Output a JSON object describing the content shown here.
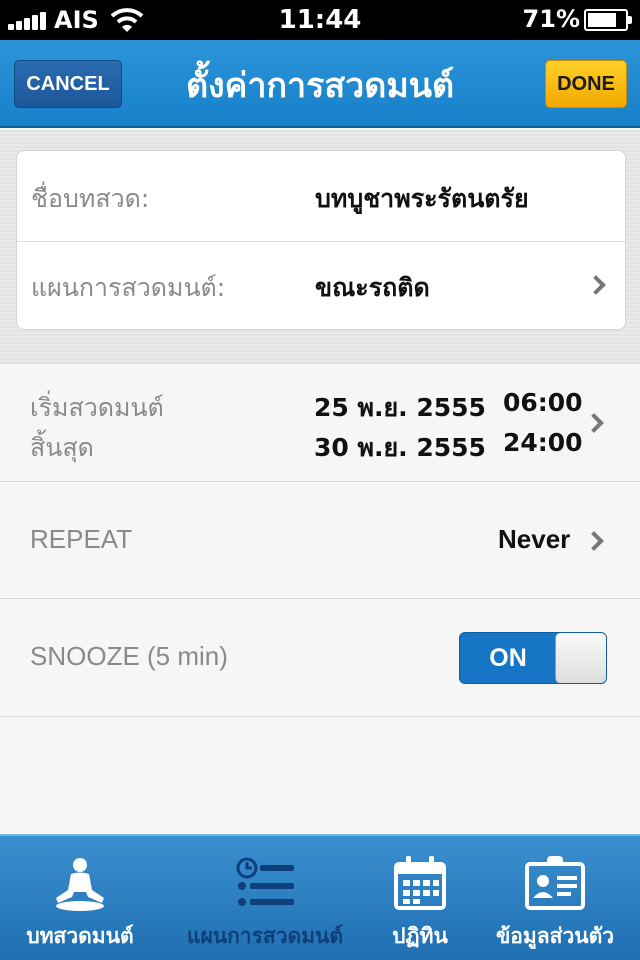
{
  "status_bar": {
    "carrier": "AIS",
    "time": "11:44",
    "battery": "71%"
  },
  "nav": {
    "title": "ตั้งค่าการสวดมนต์",
    "cancel": "CANCEL",
    "done": "DONE"
  },
  "card": {
    "chant_label": "ชื่อบทสวด:",
    "chant_value": "บทบูชาพระรัตนตรัย",
    "plan_label": "แผนการสวดมนต์:",
    "plan_value": "ขณะรถติด"
  },
  "schedule": {
    "start_label": "เริ่มสวดมนต์",
    "end_label": "สิ้นสุด",
    "start_date": "25 พ.ย. 2555",
    "start_time": "06:00",
    "end_date": "30 พ.ย. 2555",
    "end_time": "24:00"
  },
  "repeat": {
    "label": "REPEAT",
    "value": "Never"
  },
  "snooze": {
    "label": "SNOOZE (5 min)",
    "toggle": "ON",
    "is_on": true
  },
  "tabs": [
    {
      "label": "บทสวดมนต์",
      "icon": "meditation-icon",
      "active": false
    },
    {
      "label": "แผนการสวดมนต์",
      "icon": "schedule-list-icon",
      "active": true
    },
    {
      "label": "ปฏิทิน",
      "icon": "calendar-icon",
      "active": false
    },
    {
      "label": "ข้อมูลส่วนตัว",
      "icon": "profile-card-icon",
      "active": false
    }
  ]
}
